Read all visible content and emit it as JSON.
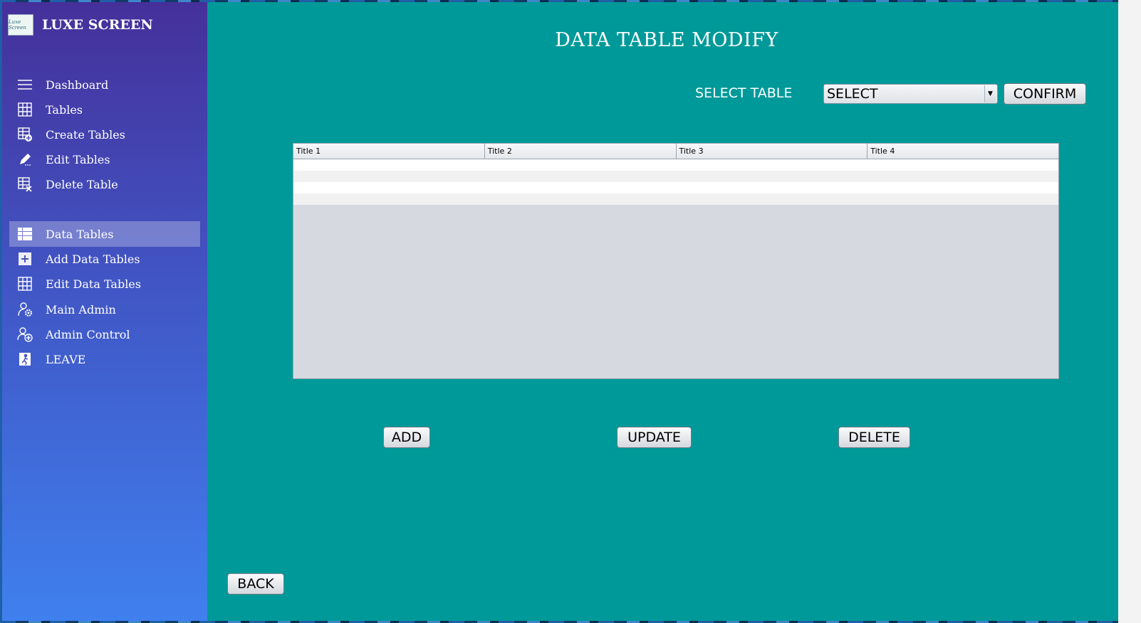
{
  "app": {
    "brand_name": "LUXE SCREEN",
    "logo_text": "Luxe Screen"
  },
  "sidebar": {
    "items": [
      {
        "label": "Dashboard",
        "icon": "menu-icon",
        "active": false
      },
      {
        "label": "Tables",
        "icon": "table-grid-icon",
        "active": false
      },
      {
        "label": "Create Tables",
        "icon": "table-add-icon",
        "active": false
      },
      {
        "label": "Edit Tables",
        "icon": "pencil-icon",
        "active": false
      },
      {
        "label": "Delete Table",
        "icon": "table-delete-icon",
        "active": false
      },
      {
        "label": "Data Tables",
        "icon": "data-grid-icon",
        "active": true
      },
      {
        "label": "Add Data Tables",
        "icon": "plus-square-icon",
        "active": false
      },
      {
        "label": "Edit Data Tables",
        "icon": "table-grid-icon",
        "active": false
      },
      {
        "label": "Main Admin",
        "icon": "admin-gear-icon",
        "active": false
      },
      {
        "label": "Admin Control",
        "icon": "user-add-icon",
        "active": false
      },
      {
        "label": "LEAVE",
        "icon": "exit-icon",
        "active": false
      }
    ]
  },
  "main": {
    "title": "DATA TABLE MODIFY",
    "select_label": "SELECT TABLE",
    "select_value": "SELECT",
    "confirm_label": "CONFIRM",
    "table": {
      "columns": [
        "Title 1",
        "Title 2",
        "Title 3",
        "Title 4"
      ],
      "rows": [
        [
          "",
          "",
          "",
          ""
        ],
        [
          "",
          "",
          "",
          ""
        ],
        [
          "",
          "",
          "",
          ""
        ],
        [
          "",
          "",
          "",
          ""
        ]
      ]
    },
    "add_label": "ADD",
    "update_label": "UPDATE",
    "delete_label": "DELETE",
    "back_label": "BACK"
  },
  "colors": {
    "main_bg": "#009999",
    "sidebar_top": "#45309a",
    "sidebar_bottom": "#3f80ee"
  }
}
